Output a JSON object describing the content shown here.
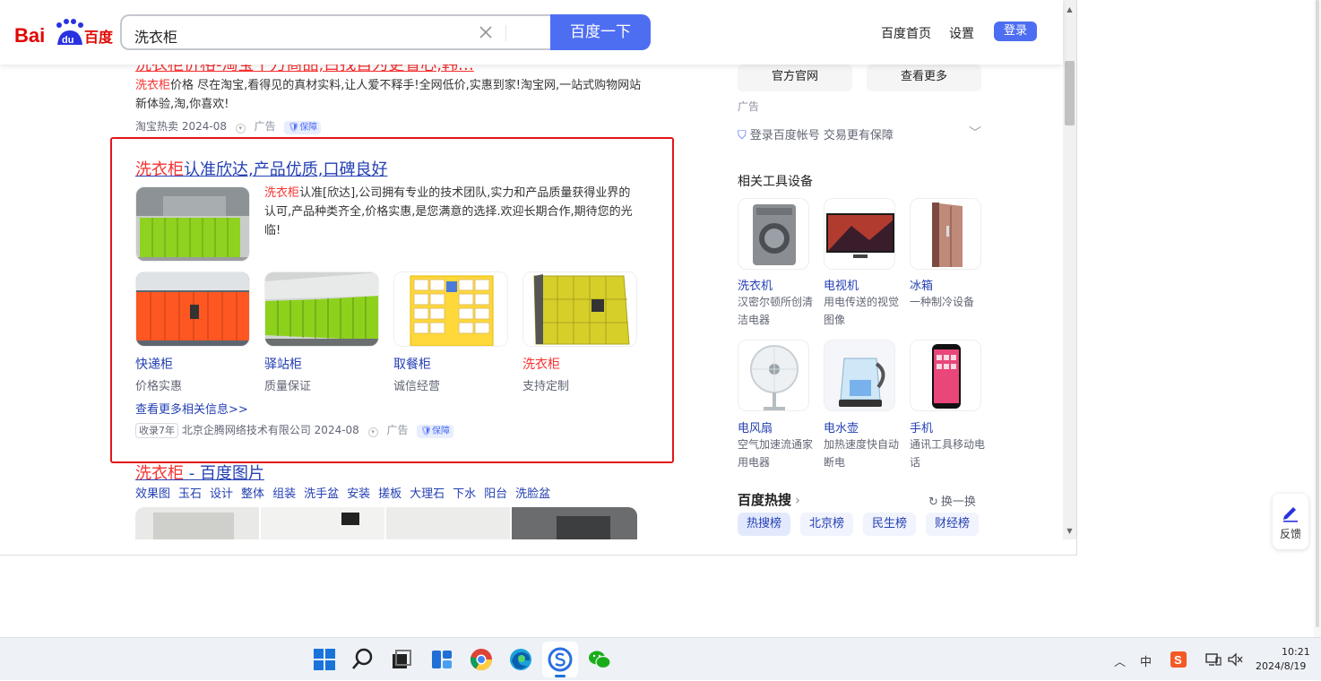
{
  "header": {
    "logo_text": "Bai百度",
    "search_value": "洗衣柜",
    "search_button": "百度一下",
    "nav": [
      "百度首页",
      "设置"
    ],
    "login": "登录"
  },
  "results": {
    "r0": {
      "title_partial": "洗衣柜价格-淘宝千万商品,白找自为更省心,韩…",
      "desc_red": "洗衣柜",
      "desc": "价格 尽在淘宝,看得见的真材实料,让人爱不释手!全网低价,实惠到家!淘宝网,一站式购物网站新体验,淘,你喜欢!",
      "source": "淘宝热卖",
      "date": "2024-08",
      "ad": "广告",
      "bao": "保障"
    },
    "r1": {
      "title_red": "洗衣柜",
      "title_rest": "认准欣达,产品优质,口碑良好",
      "desc_red": "洗衣柜",
      "desc": "认准[欣达],公司拥有专业的技术团队,实力和产品质量获得业界的认可,产品种类齐全,价格实惠,是您满意的选择.欢迎长期合作,期待您的光临!",
      "items": [
        {
          "name": "快递柜",
          "sub": "价格实惠"
        },
        {
          "name": "驿站柜",
          "sub": "质量保证"
        },
        {
          "name": "取餐柜",
          "sub": "诚信经营"
        },
        {
          "name": "洗衣柜",
          "sub": "支持定制"
        }
      ],
      "more": "查看更多相关信息>>",
      "badge": "收录7年",
      "source": "北京企腾网络技术有限公司",
      "date": "2024-08",
      "ad": "广告",
      "bao": "保障"
    },
    "r2": {
      "title_red": "洗衣柜",
      "title_rest": " - 百度图片",
      "tags": [
        "效果图",
        "玉石",
        "设计",
        "整体",
        "组装",
        "洗手盆",
        "安装",
        "搓板",
        "大理石",
        "下水",
        "阳台",
        "洗脸盆"
      ]
    }
  },
  "sidebar": {
    "btn_official": "官方官网",
    "btn_more": "查看更多",
    "ad": "广告",
    "login_tip": "登录百度帐号 交易更有保障",
    "tools_title": "相关工具设备",
    "tools": [
      {
        "name": "洗衣机",
        "desc": "汉密尔顿所创清洁电器"
      },
      {
        "name": "电视机",
        "desc": "用电传送的视觉图像"
      },
      {
        "name": "冰箱",
        "desc": "一种制冷设备"
      },
      {
        "name": "电风扇",
        "desc": "空气加速流通家用电器"
      },
      {
        "name": "电水壶",
        "desc": "加热速度快自动断电"
      },
      {
        "name": "手机",
        "desc": "通讯工具移动电话"
      }
    ],
    "hot_title": "百度热搜",
    "refresh": "换一换",
    "hot_tabs": [
      "热搜榜",
      "北京榜",
      "民生榜",
      "财经榜"
    ]
  },
  "feedback": "反馈",
  "taskbar": {
    "ime": "中",
    "time": "10:21",
    "date": "2024/8/19"
  },
  "colors": {
    "accent": "#4e6ef2",
    "link": "#2440b3",
    "highlight": "#f73131",
    "annotation": "#e2161a"
  }
}
